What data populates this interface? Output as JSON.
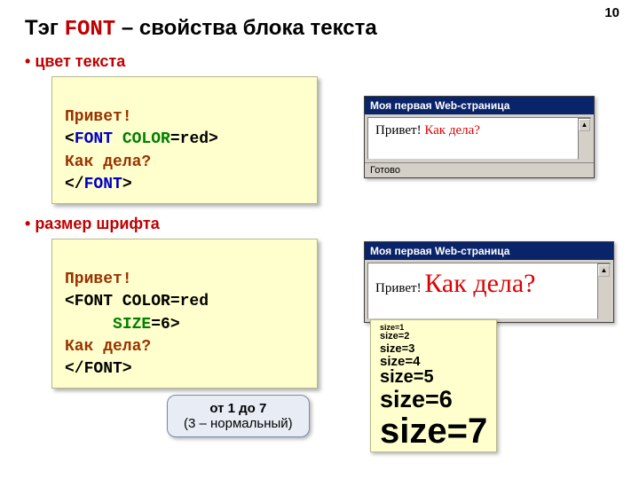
{
  "page_number": "10",
  "title_prefix": "Тэг ",
  "title_tag": "FONT",
  "title_suffix": " – свойства блока текста",
  "bullets": {
    "color": "цвет текста",
    "size": "размер шрифта"
  },
  "code1": {
    "l1": "Привет!",
    "l2a": "<",
    "l2b": "FONT",
    "l2c": " COLOR",
    "l2d": "=red>",
    "l3": "Как дела?",
    "l4a": "</",
    "l4b": "FONT",
    "l4c": ">"
  },
  "code2": {
    "l1": "Привет!",
    "l2": "<FONT COLOR=red",
    "l3a": "     ",
    "l3b": "SIZE",
    "l3c": "=6>",
    "l4": "Как дела?",
    "l5": "</FONT>"
  },
  "browser1": {
    "title": "Моя первая Web-страница",
    "text_black": "Привет! ",
    "text_red": "Как дела?",
    "status": "Готово"
  },
  "browser2": {
    "title": "Моя первая Web-страница",
    "text_black": "Привет! ",
    "text_red": "Как дела?"
  },
  "sizes": {
    "s1": "size=1",
    "s2": "size=2",
    "s3": "size=3",
    "s4": "size=4",
    "s5": "size=5",
    "s6": "size=6",
    "s7": "size=7"
  },
  "callout": {
    "line1": "от 1 до 7",
    "line2": "(3 – нормальный)"
  }
}
